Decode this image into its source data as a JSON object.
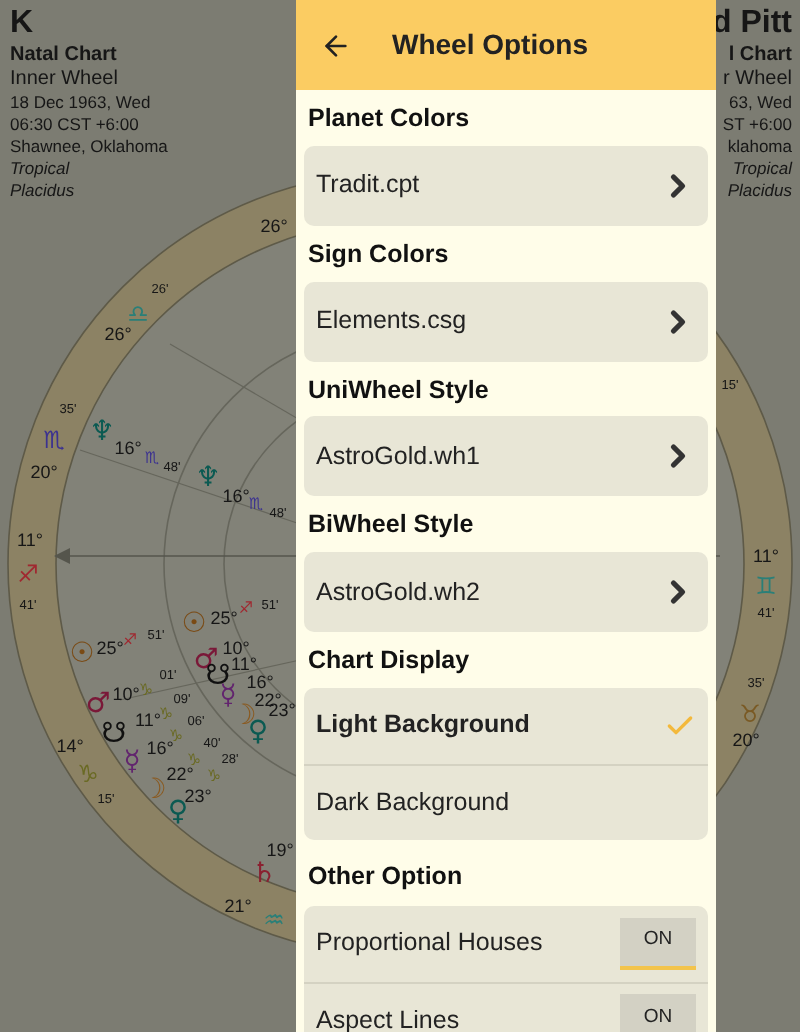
{
  "chart_header": {
    "name": "K",
    "title": "Natal Chart",
    "wheel": "Inner Wheel",
    "date": "18 Dec 1963, Wed",
    "time": "06:30 CST +6:00",
    "place": "Shawnee, Oklahoma",
    "zodiac": "Tropical",
    "houses": "Placidus"
  },
  "second_header": {
    "name": "d Pitt",
    "title": "l Chart",
    "wheel": "r Wheel",
    "date": "63, Wed",
    "time": "ST +6:00",
    "place": "klahoma",
    "zodiac": "Tropical",
    "houses": "Placidus"
  },
  "chart_labels": [
    {
      "text": "26°",
      "kind": "degree",
      "color": "#161616"
    },
    {
      "text": "26'",
      "kind": "minute",
      "color": "#161616"
    },
    {
      "text": "♎",
      "kind": "sign",
      "color": "#2a7f78"
    },
    {
      "text": "26°",
      "kind": "degree",
      "color": "#161616"
    },
    {
      "text": "35'",
      "kind": "minute",
      "color": "#161616"
    },
    {
      "text": "♏",
      "kind": "sign",
      "color": "#3c3290"
    },
    {
      "text": "20°",
      "kind": "degree",
      "color": "#161616"
    },
    {
      "text": "♆",
      "kind": "planet",
      "color": "#0b5a52"
    },
    {
      "text": "16°",
      "kind": "degree",
      "color": "#161616"
    },
    {
      "text": "♏",
      "kind": "small_sign",
      "color": "#3c3290"
    },
    {
      "text": "48'",
      "kind": "minute",
      "color": "#161616"
    },
    {
      "text": "♆",
      "kind": "planet",
      "color": "#0b5a52"
    },
    {
      "text": "16°",
      "kind": "degree",
      "color": "#161616"
    },
    {
      "text": "♏",
      "kind": "small_sign",
      "color": "#3c3290"
    },
    {
      "text": "48'",
      "kind": "minute",
      "color": "#161616"
    },
    {
      "text": "11°",
      "kind": "degree",
      "color": "#161616"
    },
    {
      "text": "♐",
      "kind": "sign",
      "color": "#a02830"
    },
    {
      "text": "41'",
      "kind": "minute",
      "color": "#161616"
    },
    {
      "text": "☉",
      "kind": "planet",
      "color": "#7a4a14"
    },
    {
      "text": "25°",
      "kind": "degree",
      "color": "#161616"
    },
    {
      "text": "♐",
      "kind": "small_sign",
      "color": "#a02830"
    },
    {
      "text": "51'",
      "kind": "minute",
      "color": "#161616"
    },
    {
      "text": "♂",
      "kind": "planet",
      "color": "#7a1838"
    },
    {
      "text": "10°",
      "kind": "degree",
      "color": "#161616"
    },
    {
      "text": "♑",
      "kind": "small_sign",
      "color": "#6a6a24"
    },
    {
      "text": "01'",
      "kind": "minute",
      "color": "#161616"
    },
    {
      "text": "☋",
      "kind": "planet",
      "color": "#101010"
    },
    {
      "text": "11°",
      "kind": "degree",
      "color": "#161616"
    },
    {
      "text": "♑",
      "kind": "small_sign",
      "color": "#6a6a24"
    },
    {
      "text": "09'",
      "kind": "minute",
      "color": "#161616"
    },
    {
      "text": "06'",
      "kind": "minute",
      "color": "#161616"
    },
    {
      "text": "☿",
      "kind": "planet",
      "color": "#62246e"
    },
    {
      "text": "16°",
      "kind": "degree",
      "color": "#161616"
    },
    {
      "text": "♑",
      "kind": "small_sign",
      "color": "#6a6a24"
    },
    {
      "text": "40'",
      "kind": "minute",
      "color": "#161616"
    },
    {
      "text": "☽",
      "kind": "planet",
      "color": "#8a5a20"
    },
    {
      "text": "22°",
      "kind": "degree",
      "color": "#161616"
    },
    {
      "text": "♑",
      "kind": "small_sign",
      "color": "#6a6a24"
    },
    {
      "text": "28'",
      "kind": "minute",
      "color": "#161616"
    },
    {
      "text": "♀",
      "kind": "planet",
      "color": "#0b5a52"
    },
    {
      "text": "23°",
      "kind": "degree",
      "color": "#161616"
    },
    {
      "text": "♑",
      "kind": "small_sign",
      "color": "#6a6a24"
    },
    {
      "text": "14°",
      "kind": "degree",
      "color": "#161616"
    },
    {
      "text": "♑",
      "kind": "sign",
      "color": "#6a6a24"
    },
    {
      "text": "15'",
      "kind": "minute",
      "color": "#161616"
    },
    {
      "text": "☉",
      "kind": "planet",
      "color": "#7a4a14"
    },
    {
      "text": "25°",
      "kind": "degree",
      "color": "#161616"
    },
    {
      "text": "♐",
      "kind": "small_sign",
      "color": "#a02830"
    },
    {
      "text": "51'",
      "kind": "minute",
      "color": "#161616"
    },
    {
      "text": "♂",
      "kind": "planet",
      "color": "#7a1838"
    },
    {
      "text": "10°",
      "kind": "degree",
      "color": "#161616"
    },
    {
      "text": "☋",
      "kind": "planet",
      "color": "#101010"
    },
    {
      "text": "11°",
      "kind": "degree",
      "color": "#161616"
    },
    {
      "text": "☿",
      "kind": "planet",
      "color": "#62246e"
    },
    {
      "text": "16°",
      "kind": "degree",
      "color": "#161616"
    },
    {
      "text": "☽",
      "kind": "planet",
      "color": "#8a5a20"
    },
    {
      "text": "22°",
      "kind": "degree",
      "color": "#161616"
    },
    {
      "text": "♀",
      "kind": "planet",
      "color": "#0b5a52"
    },
    {
      "text": "23°",
      "kind": "degree",
      "color": "#161616"
    },
    {
      "text": "♄",
      "kind": "planet",
      "color": "#8a2030"
    },
    {
      "text": "19°",
      "kind": "degree",
      "color": "#161616"
    },
    {
      "text": "21°",
      "kind": "degree",
      "color": "#161616"
    },
    {
      "text": "♒",
      "kind": "sign",
      "color": "#2a7f78"
    },
    {
      "text": "15'",
      "kind": "minute",
      "color": "#161616"
    },
    {
      "text": "11°",
      "kind": "degree",
      "color": "#161616"
    },
    {
      "text": "♊",
      "kind": "sign",
      "color": "#2a7f78"
    },
    {
      "text": "41'",
      "kind": "minute",
      "color": "#161616"
    },
    {
      "text": "35'",
      "kind": "minute",
      "color": "#161616"
    },
    {
      "text": "♉",
      "kind": "sign",
      "color": "#7a5a24"
    },
    {
      "text": "20°",
      "kind": "degree",
      "color": "#161616"
    }
  ],
  "dialog": {
    "title": "Wheel Options",
    "sections": [
      {
        "heading": "Planet Colors",
        "kind": "file",
        "items": [
          {
            "label": "Tradit.cpt"
          }
        ]
      },
      {
        "heading": "Sign Colors",
        "kind": "file",
        "items": [
          {
            "label": "Elements.csg"
          }
        ]
      },
      {
        "heading": "UniWheel Style",
        "kind": "file",
        "items": [
          {
            "label": "AstroGold.wh1"
          }
        ]
      },
      {
        "heading": "BiWheel Style",
        "kind": "file",
        "items": [
          {
            "label": "AstroGold.wh2"
          }
        ]
      },
      {
        "heading": "Chart Display",
        "kind": "choice",
        "items": [
          {
            "label": "Light Background",
            "selected": true
          },
          {
            "label": "Dark Background",
            "selected": false
          }
        ]
      },
      {
        "heading": "Other Option",
        "kind": "toggle",
        "items": [
          {
            "label": "Proportional Houses",
            "on": true,
            "state": "ON"
          },
          {
            "label": "Aspect Lines",
            "on": true,
            "state": "ON"
          }
        ]
      }
    ]
  }
}
